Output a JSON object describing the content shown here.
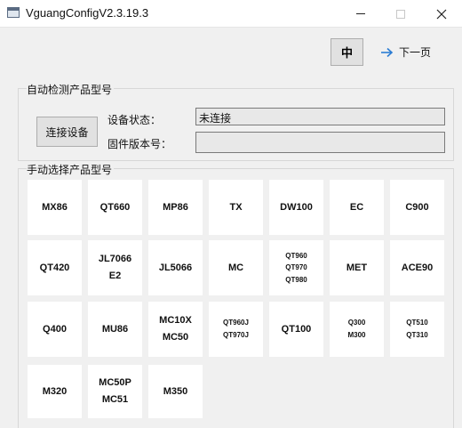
{
  "window": {
    "title": "VguangConfigV2.3.19.3",
    "minimize_icon": "minimize-icon",
    "maximize_icon": "maximize-icon",
    "close_icon": "close-icon"
  },
  "toolbar": {
    "language_label": "中",
    "next_page_label": "下一页",
    "next_icon": "arrow-right-icon",
    "accent_color": "#2b7cd3"
  },
  "auto_detect": {
    "group_title": "自动检测产品型号",
    "connect_label": "连接设备",
    "status_label": "设备状态：",
    "status_value": "未连接",
    "firmware_label": "固件版本号：",
    "firmware_value": ""
  },
  "manual_select": {
    "group_title": "手动选择产品型号",
    "models": [
      {
        "name": "model-mx86",
        "lines": [
          "MX86"
        ],
        "small": false
      },
      {
        "name": "model-qt660",
        "lines": [
          "QT660"
        ],
        "small": false
      },
      {
        "name": "model-mp86",
        "lines": [
          "MP86"
        ],
        "small": false
      },
      {
        "name": "model-tx",
        "lines": [
          "TX"
        ],
        "small": false
      },
      {
        "name": "model-dw100",
        "lines": [
          "DW100"
        ],
        "small": false
      },
      {
        "name": "model-ec",
        "lines": [
          "EC"
        ],
        "small": false
      },
      {
        "name": "model-c900",
        "lines": [
          "C900"
        ],
        "small": false
      },
      {
        "name": "model-qt420",
        "lines": [
          "QT420"
        ],
        "small": false
      },
      {
        "name": "model-jl7066-e2",
        "lines": [
          "JL7066",
          "E2"
        ],
        "small": false
      },
      {
        "name": "model-jl5066",
        "lines": [
          "JL5066"
        ],
        "small": false
      },
      {
        "name": "model-mc",
        "lines": [
          "MC"
        ],
        "small": false
      },
      {
        "name": "model-qt960-qt970-qt980",
        "lines": [
          "QT960",
          "QT970",
          "QT980"
        ],
        "small": true
      },
      {
        "name": "model-met",
        "lines": [
          "MET"
        ],
        "small": false
      },
      {
        "name": "model-ace90",
        "lines": [
          "ACE90"
        ],
        "small": false
      },
      {
        "name": "model-q400",
        "lines": [
          "Q400"
        ],
        "small": false
      },
      {
        "name": "model-mu86",
        "lines": [
          "MU86"
        ],
        "small": false
      },
      {
        "name": "model-mc10x-mc50",
        "lines": [
          "MC10X",
          "MC50"
        ],
        "small": false
      },
      {
        "name": "model-qt960j-qt970j",
        "lines": [
          "QT960J",
          "QT970J"
        ],
        "small": true
      },
      {
        "name": "model-qt100",
        "lines": [
          "QT100"
        ],
        "small": false
      },
      {
        "name": "model-q300-m300",
        "lines": [
          "Q300",
          "M300"
        ],
        "small": true
      },
      {
        "name": "model-qt510-qt310",
        "lines": [
          "QT510",
          "QT310"
        ],
        "small": true
      },
      {
        "name": "model-m320",
        "lines": [
          "M320"
        ],
        "small": false
      },
      {
        "name": "model-mc50p-mc51",
        "lines": [
          "MC50P",
          "MC51"
        ],
        "small": false
      },
      {
        "name": "model-m350",
        "lines": [
          "M350"
        ],
        "small": false
      }
    ]
  }
}
